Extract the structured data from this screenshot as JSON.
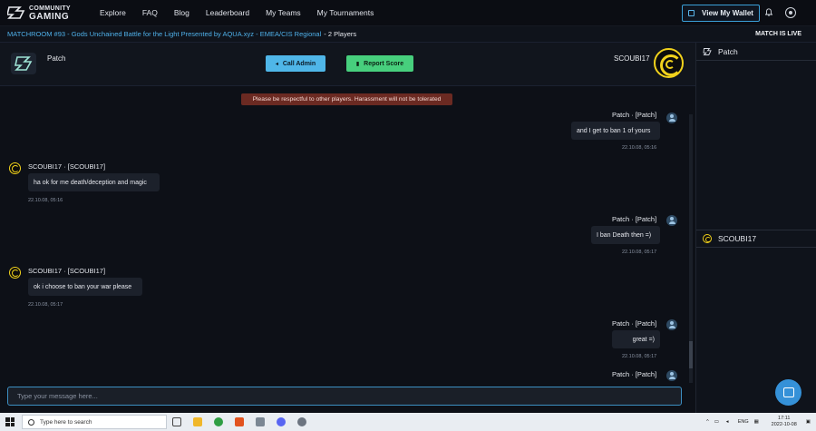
{
  "nav": {
    "logo_line1": "COMMUNITY",
    "logo_line2": "GAMING",
    "links": [
      "Explore",
      "FAQ",
      "Blog",
      "Leaderboard",
      "My Teams",
      "My Tournaments"
    ],
    "wallet_label": "View My Wallet"
  },
  "match": {
    "title": "MATCHROOM #93 - Gods Unchained Battle for the Light Presented by AQUA.xyz - EMEA/CIS Regional",
    "players": "- 2 Players",
    "status": "MATCH IS LIVE"
  },
  "chat_header": {
    "left_player": "Patch",
    "call_admin": "Call Admin",
    "report_score": "Report Score",
    "right_player": "SCOUBI17"
  },
  "warning": "Please be respectful to other players. Harassment will not be tolerated",
  "messages": [
    {
      "author": "Patch · [Patch]",
      "text": "and I get to ban 1 of yours",
      "time": "22.10.08, 05:16",
      "side": "right"
    },
    {
      "author": "SCOUBI17 · [SCOUBI17]",
      "text": "ha ok for me death/deception and magic",
      "time": "22.10.08, 05:16",
      "side": "left"
    },
    {
      "author": "Patch · [Patch]",
      "text": "I ban Death then =)",
      "time": "22.10.08, 05:17",
      "side": "right"
    },
    {
      "author": "SCOUBI17 · [SCOUBI17]",
      "text": "ok i choose to ban your war please",
      "time": "22.10.08, 05:17",
      "side": "left"
    },
    {
      "author": "Patch · [Patch]",
      "text": "great =)",
      "time": "22.10.08, 05:17",
      "side": "right"
    },
    {
      "author": "Patch · [Patch]",
      "text": "",
      "time": "",
      "side": "right"
    }
  ],
  "input": {
    "placeholder": "Type your message here..."
  },
  "right_panel": {
    "player1": "Patch",
    "player2": "SCOUBI17"
  },
  "taskbar": {
    "search_placeholder": "Type here to search",
    "lang": "ENG",
    "time": "17:11",
    "date": "2022-10-08"
  },
  "colors": {
    "accent_blue": "#4fb6e8",
    "accent_green": "#47cf7d",
    "warning_bg": "#6b2a22",
    "scoubi_yellow": "#f1d21c"
  }
}
